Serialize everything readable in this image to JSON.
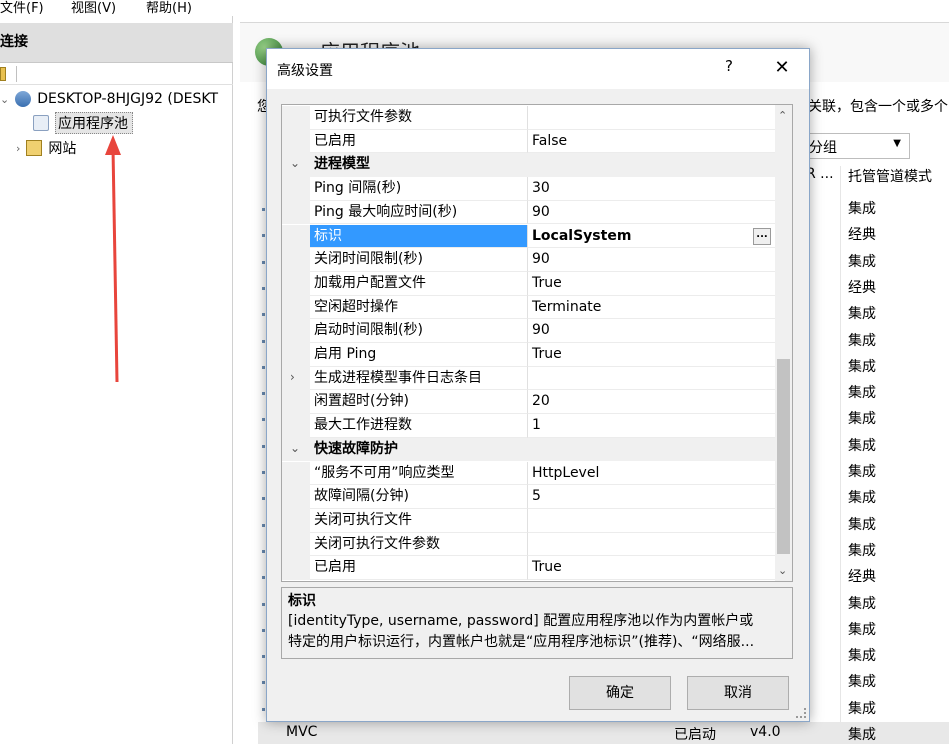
{
  "menubar": {
    "file": "文件(F)",
    "view": "视图(V)",
    "help": "帮助(H)"
  },
  "connections": {
    "header": "连接",
    "server_node": "DESKTOP-8HJGJ92 (DESKT",
    "app_pools": "应用程序池",
    "sites": "网站"
  },
  "main": {
    "title": "应用程序池",
    "description_start": "您",
    "description_tail": "关联，包含一个或多个",
    "group_by": "分组",
    "col_r": "R ...",
    "col_pipeline": "托管管道模式",
    "pipeline_modes": [
      "集成",
      "经典",
      "集成",
      "经典",
      "集成",
      "集成",
      "集成",
      "集成",
      "集成",
      "集成",
      "集成",
      "集成",
      "集成",
      "集成",
      "经典",
      "集成",
      "集成",
      "集成",
      "集成",
      "集成"
    ],
    "bottom_row": {
      "name": "MVC",
      "status": "已启动",
      "version": "v4.0",
      "pipeline": "集成"
    }
  },
  "dialog": {
    "title": "高级设置",
    "help": "?",
    "close": "✕",
    "rows": [
      {
        "name": "可执行文件参数",
        "value": ""
      },
      {
        "name": "已启用",
        "value": "False"
      },
      {
        "name": "进程模型",
        "value": ""
      },
      {
        "name": "Ping 间隔(秒)",
        "value": "30"
      },
      {
        "name": "Ping 最大响应时间(秒)",
        "value": "90"
      },
      {
        "name": "标识",
        "value": "LocalSystem"
      },
      {
        "name": "关闭时间限制(秒)",
        "value": "90"
      },
      {
        "name": "加载用户配置文件",
        "value": "True"
      },
      {
        "name": "空闲超时操作",
        "value": "Terminate"
      },
      {
        "name": "启动时间限制(秒)",
        "value": "90"
      },
      {
        "name": "启用 Ping",
        "value": "True"
      },
      {
        "name": "生成进程模型事件日志条目",
        "value": ""
      },
      {
        "name": "闲置超时(分钟)",
        "value": "20"
      },
      {
        "name": "最大工作进程数",
        "value": "1"
      },
      {
        "name": "快速故障防护",
        "value": ""
      },
      {
        "name": "“服务不可用”响应类型",
        "value": "HttpLevel"
      },
      {
        "name": "故障间隔(分钟)",
        "value": "5"
      },
      {
        "name": "关闭可执行文件",
        "value": ""
      },
      {
        "name": "关闭可执行文件参数",
        "value": ""
      },
      {
        "name": "已启用",
        "value": "True"
      }
    ],
    "ellipsis": "...",
    "desc_title": "标识",
    "desc_line1": "[identityType, username, password] 配置应用程序池以作为内置帐户或",
    "desc_line2": "特定的用户标识运行，内置帐户也就是“应用程序池标识”(推荐)、“网络服...",
    "ok": "确定",
    "cancel": "取消"
  },
  "colors": {
    "selection": "#3399ff",
    "arrow": "#e8453c"
  }
}
